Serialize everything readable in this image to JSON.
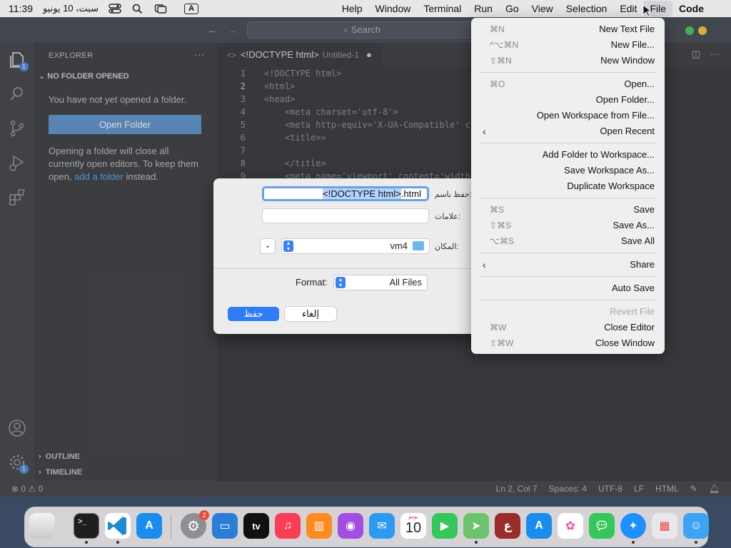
{
  "menubar": {
    "clock": "11:39",
    "date": "سبت، 10 يونيو",
    "input_indicator": "A",
    "items": [
      "Help",
      "Window",
      "Terminal",
      "Run",
      "Go",
      "View",
      "Selection",
      "Edit",
      "File",
      "Code"
    ]
  },
  "vscode": {
    "search_placeholder": "Search",
    "explorer": {
      "title": "EXPLORER",
      "section": "NO FOLDER OPENED",
      "message": "You have not yet opened a folder.",
      "open_folder_button": "Open Folder",
      "info_part1": "Opening a folder will close all currently open editors. To keep them open, ",
      "info_link": "add a folder",
      "info_part2": " instead.",
      "outline": "OUTLINE",
      "timeline": "TIMELINE",
      "badge_explorer": "1",
      "badge_settings": "1"
    },
    "tab": {
      "title": "<!DOCTYPE html>",
      "subtitle": "Untitled-1"
    },
    "code_lines": [
      {
        "n": "1",
        "text": "<!DOCTYPE html>"
      },
      {
        "n": "2",
        "text": "<html>"
      },
      {
        "n": "3",
        "text": "<head>"
      },
      {
        "n": "4",
        "text": "    <meta charset='utf-8'>"
      },
      {
        "n": "5",
        "text": "    <meta http-equiv='X-UA-Compatible' c"
      },
      {
        "n": "6",
        "text": "    <title>>"
      },
      {
        "n": "7",
        "text": ""
      },
      {
        "n": "8",
        "text": "    </title>"
      },
      {
        "n": "9",
        "text": "    <meta name='viewport' content='width"
      }
    ],
    "status": {
      "problems": "⊗ 0 ⚠ 0",
      "position": "Ln 2, Col 7",
      "spaces": "Spaces: 4",
      "encoding": "UTF-8",
      "eol": "LF",
      "language": "HTML"
    }
  },
  "save_dialog": {
    "name_label": "حفظ باسم:",
    "name_selected": "<!DOCTYPE html>",
    "name_ext": ".html",
    "tags_label": "علامات:",
    "location_label": "المكان:",
    "location_value": "vm4",
    "format_label": "Format:",
    "format_value": "All Files",
    "save_button": "حفظ",
    "cancel_button": "إلغاء"
  },
  "file_menu": {
    "items": [
      {
        "label": "New Text File",
        "shortcut": "⌘N"
      },
      {
        "label": "New File...",
        "shortcut": "^⌥⌘N"
      },
      {
        "label": "New Window",
        "shortcut": "⇧⌘N"
      },
      {
        "label": "Open...",
        "shortcut": "⌘O"
      },
      {
        "label": "Open Folder...",
        "shortcut": ""
      },
      {
        "label": "Open Workspace from File...",
        "shortcut": ""
      },
      {
        "label": "Open Recent",
        "shortcut": ""
      },
      {
        "label": "Add Folder to Workspace...",
        "shortcut": ""
      },
      {
        "label": "Save Workspace As...",
        "shortcut": ""
      },
      {
        "label": "Duplicate Workspace",
        "shortcut": ""
      },
      {
        "label": "Save",
        "shortcut": "⌘S"
      },
      {
        "label": "Save As...",
        "shortcut": "⇧⌘S"
      },
      {
        "label": "Save All",
        "shortcut": "⌥⌘S"
      },
      {
        "label": "Share",
        "shortcut": ""
      },
      {
        "label": "Auto Save",
        "shortcut": ""
      },
      {
        "label": "Revert File",
        "shortcut": ""
      },
      {
        "label": "Close Editor",
        "shortcut": "⌘W"
      },
      {
        "label": "Close Window",
        "shortcut": "⇧⌘W"
      }
    ]
  },
  "dock": {
    "settings_badge": "2",
    "calendar_month": "يونيو",
    "calendar_day": "10",
    "tv_label": "tv",
    "dictionary_label": "ع",
    "apps": [
      "Trash",
      "Terminal",
      "Visual Studio Code",
      "Xcode / Instruments",
      "System Settings",
      "Keynote",
      "Apple TV",
      "Music",
      "Books",
      "Podcasts",
      "Mail",
      "Calendar",
      "FaceTime",
      "Maps",
      "Dictionary",
      "App Store",
      "Photos",
      "Messages",
      "Safari",
      "Launchpad",
      "Finder"
    ]
  }
}
